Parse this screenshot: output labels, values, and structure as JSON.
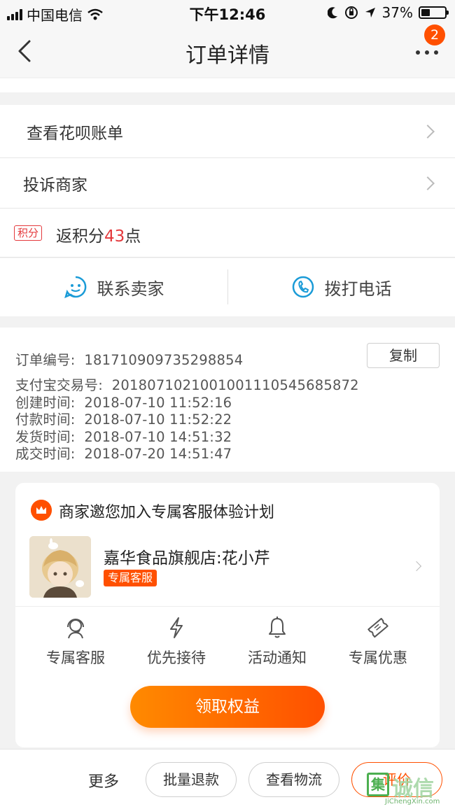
{
  "status_bar": {
    "carrier": "中国电信",
    "time": "下午12:46",
    "battery": "37%",
    "battery_level": 0.37,
    "icons": [
      "signal-icon",
      "wifi-icon",
      "moon-icon",
      "rotation-lock-icon",
      "location-icon",
      "battery-icon"
    ]
  },
  "nav": {
    "title": "订单详情",
    "badge": "2",
    "icons": [
      "back-icon",
      "more-icon"
    ]
  },
  "menu": {
    "huabei": "查看花呗账单",
    "complain": "投诉商家"
  },
  "points": {
    "tag": "积分",
    "prefix": "返积分",
    "value": "43",
    "suffix": "点"
  },
  "actions": {
    "contact_seller": "联系卖家",
    "call": "拨打电话",
    "icons": [
      "chat-icon",
      "phone-icon"
    ]
  },
  "order_info": {
    "order_no_label": "订单编号:",
    "order_no": "181710909735298854",
    "copy": "复制",
    "alipay_label": "支付宝交易号:",
    "alipay_no": "2018071021001001110545685872",
    "created_label": "创建时间:",
    "created": "2018-07-10 11:52:16",
    "paid_label": "付款时间:",
    "paid": "2018-07-10 11:52:22",
    "shipped_label": "发货时间:",
    "shipped": "2018-07-10 14:51:32",
    "closed_label": "成交时间:",
    "closed": "2018-07-20 14:51:47"
  },
  "service_card": {
    "title": "商家邀您加入专属客服体验计划",
    "shop_name": "嘉华食品旗舰店:花小芹",
    "shop_tag": "专属客服",
    "benefits": [
      {
        "label": "专属客服",
        "icon": "headset-icon"
      },
      {
        "label": "优先接待",
        "icon": "lightning-icon"
      },
      {
        "label": "活动通知",
        "icon": "bell-icon"
      },
      {
        "label": "专属优惠",
        "icon": "ticket-icon"
      }
    ],
    "claim": "领取权益",
    "colors": {
      "accent": "#ff5000",
      "accent_light": "#ff8a00"
    }
  },
  "bottom": {
    "more": "更多",
    "refund": "批量退款",
    "logistics": "查看物流",
    "review": "评价"
  },
  "watermark": {
    "char": "集",
    "text": "诚信",
    "url": "JiChengXin.com"
  }
}
